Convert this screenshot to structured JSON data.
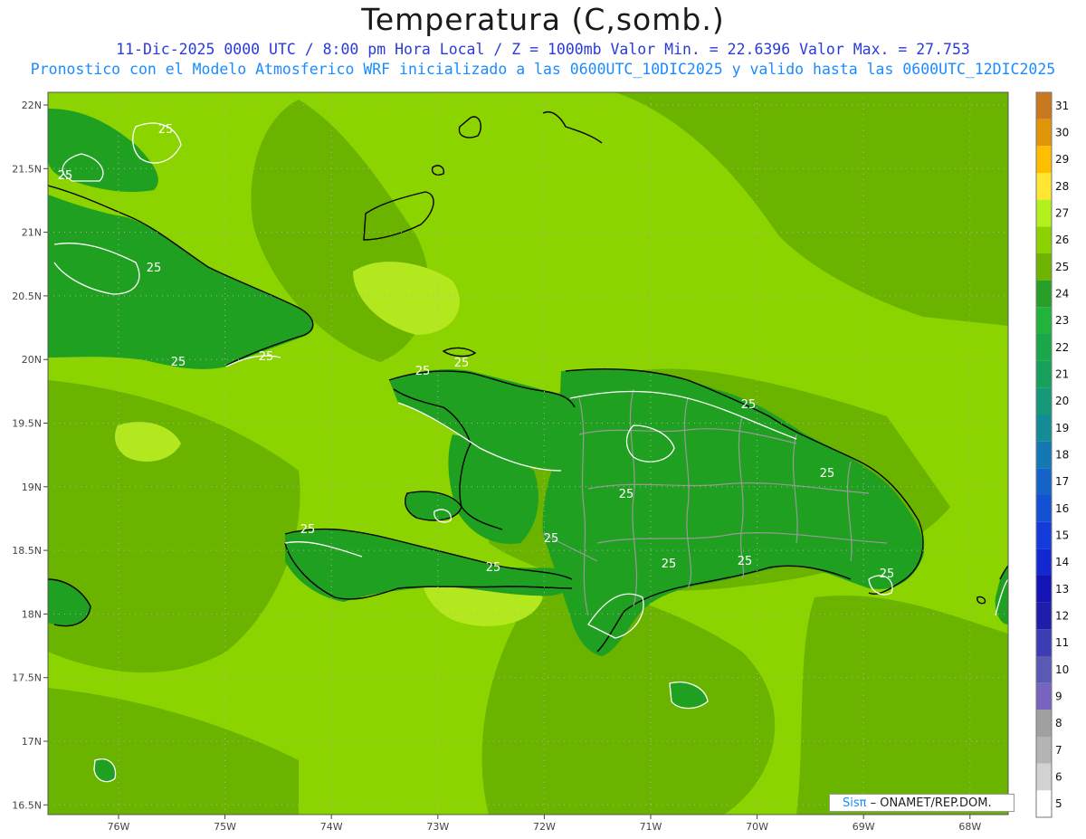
{
  "header": {
    "title": "Temperatura (C,somb.)",
    "line1": "11-Dic-2025  0000 UTC / 8:00 pm Hora Local / Z = 1000mb    Valor Min. = 22.6396  Valor Max. = 27.753",
    "line2": "Pronostico con el Modelo Atmosferico WRF inicializado a las 0600UTC_10DIC2025 y valido hasta las  0600UTC_12DIC2025"
  },
  "map": {
    "lat_labels": [
      "22N",
      "21.5N",
      "21N",
      "20.5N",
      "20N",
      "19.5N",
      "19N",
      "18.5N",
      "18N",
      "17.5N",
      "17N",
      "16.5N"
    ],
    "lon_labels": [
      "76W",
      "75W",
      "74W",
      "73W",
      "72W",
      "71W",
      "70W",
      "69W",
      "68W"
    ],
    "contour_labels": [
      "25",
      "25",
      "25",
      "25",
      "25",
      "25",
      "25",
      "25",
      "25",
      "25",
      "25",
      "25",
      "25",
      "25",
      "25",
      "25",
      "25"
    ],
    "colors": {
      "sea": "#8bd400",
      "mid": "#6ab400",
      "land": "#20a020",
      "warm": "#b4e81e"
    }
  },
  "colorbar": {
    "labels": [
      "31",
      "30",
      "29",
      "28",
      "27",
      "26",
      "25",
      "24",
      "23",
      "22",
      "21",
      "20",
      "19",
      "18",
      "17",
      "16",
      "15",
      "14",
      "13",
      "12",
      "11",
      "10",
      "9",
      "8",
      "7",
      "6",
      "5"
    ],
    "colors": [
      "#c8781e",
      "#e1960a",
      "#ffbe00",
      "#ffe632",
      "#b4f01e",
      "#8cd200",
      "#6eb400",
      "#28a028",
      "#20b43c",
      "#18a84a",
      "#16a05a",
      "#149a78",
      "#148c96",
      "#1478b4",
      "#1464c8",
      "#1450d2",
      "#143cdc",
      "#1428d2",
      "#1414b4",
      "#1e1eaa",
      "#3c3cb4",
      "#5a5ab4",
      "#7864be",
      "#a0a0a0",
      "#b4b4b4",
      "#d2d2d2",
      "#ffffff"
    ]
  },
  "credit": {
    "brand": "Sisπ",
    "text": " – ONAMET/REP.DOM."
  }
}
